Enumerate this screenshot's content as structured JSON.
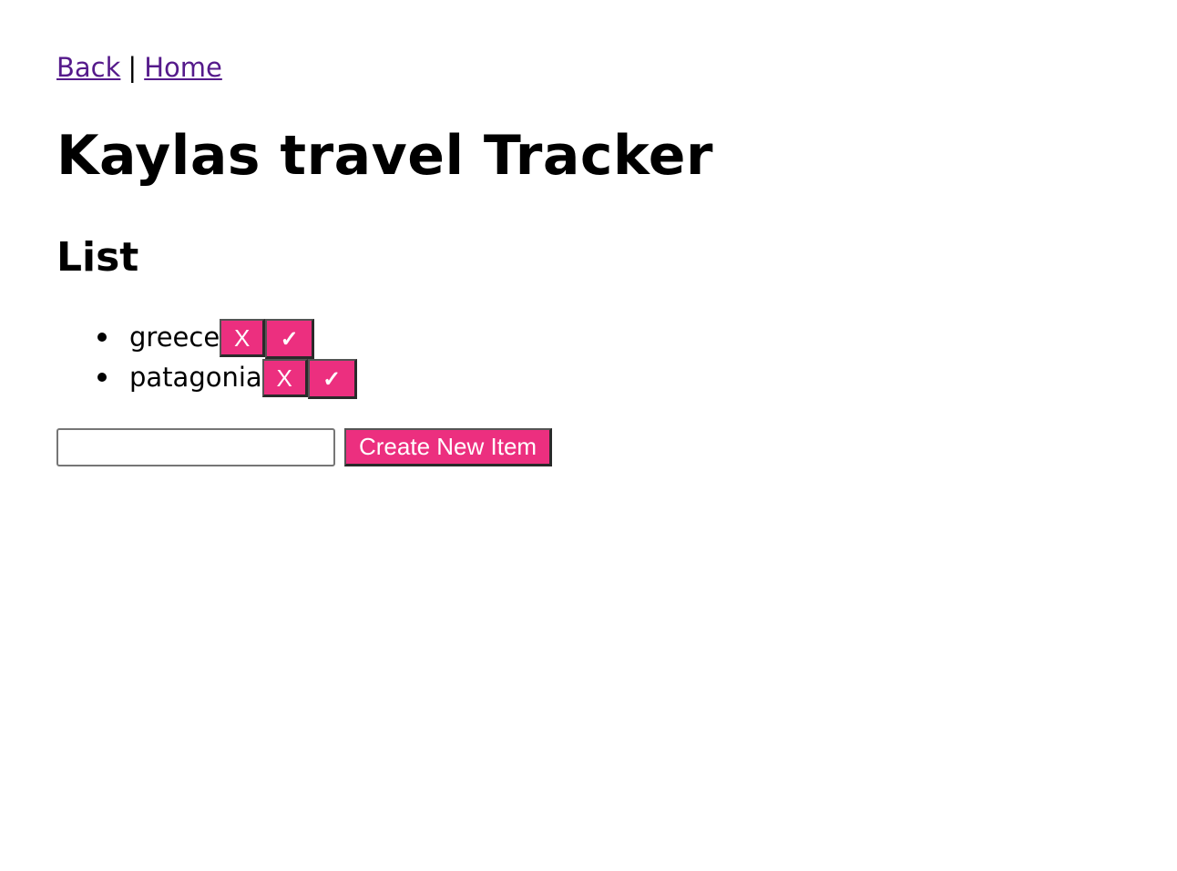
{
  "nav": {
    "back_label": "Back",
    "separator": "|",
    "home_label": "Home"
  },
  "page": {
    "title": "Kaylas travel Tracker",
    "subtitle": "List"
  },
  "list": {
    "items": [
      {
        "text": "greece",
        "remove_label": "X",
        "complete_label": "✓"
      },
      {
        "text": "patagonia",
        "remove_label": "X",
        "complete_label": "✓"
      }
    ]
  },
  "create": {
    "input_value": "",
    "button_label": "Create New Item"
  },
  "colors": {
    "button_bg": "#ec2f7f",
    "link": "#551a8b"
  }
}
